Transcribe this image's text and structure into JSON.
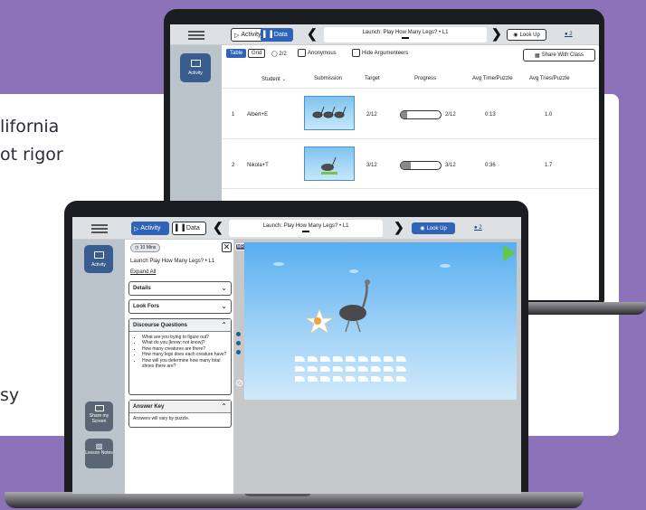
{
  "hero_text": {
    "line1": "lifornia",
    "line2": "ot rigor",
    "line3": "sy"
  },
  "back_app": {
    "sidebar": {
      "activity_label": "Activity"
    },
    "header": {
      "activity_tab": "Activity",
      "data_tab": "Data",
      "title": "Launch: Play How Many Legs? • L1",
      "lookup_label": "Look Up",
      "user_count": "2"
    },
    "toolbar": {
      "table_label": "Table",
      "grid_label": "Grid",
      "student_count": "2/2",
      "anonymous_label": "Anonymous",
      "hide_label": "Hide Argumenteers",
      "share_label": "Share With Class"
    },
    "table": {
      "headers": [
        "Student",
        "Submission",
        "Target",
        "Progress",
        "Avg Time/Puzzle",
        "Avg Tries/Puzzle"
      ],
      "rows": [
        {
          "num": "1",
          "name": "Albert+E",
          "target": "2/12",
          "progress": "2/12",
          "progress_value": 0.17,
          "avg_time": "0:13",
          "avg_tries": "1.0"
        },
        {
          "num": "2",
          "name": "Nikola+T",
          "target": "3/12",
          "progress": "3/12",
          "progress_value": 0.25,
          "avg_time": "0:36",
          "avg_tries": "1.7"
        }
      ]
    }
  },
  "front_app": {
    "sidebar": {
      "activity_label": "Activity",
      "share_screen_label": "Share my Screen",
      "lesson_notes_label": "Lesson Notes"
    },
    "header": {
      "activity_tab": "Activity",
      "data_tab": "Data",
      "title": "Launch: Play How Many Legs? • L1",
      "lookup_label": "Look Up",
      "user_count": "2"
    },
    "panel": {
      "timer": "10 Mins",
      "lesson_title": "Launch Play How Many Legs? • L1",
      "expand_all": "Expand All",
      "details_label": "Details",
      "look_fors_label": "Look Fors",
      "discourse_label": "Discourse Questions",
      "questions": [
        "What are you trying to figure out?",
        "What do you [know; not know]?",
        "How many creatures are there?",
        "How many legs does each creature have?",
        "How will you determine how many total shoes there are?"
      ],
      "answer_key_label": "Answer Key",
      "answer_text": "Answers will vary by puzzle."
    },
    "game": {
      "mr_label": "MR"
    }
  },
  "colors": {
    "brand_blue": "#2f63b7",
    "sidebar_blue": "#3a5d8f",
    "background_purple": "#8c72b8"
  }
}
